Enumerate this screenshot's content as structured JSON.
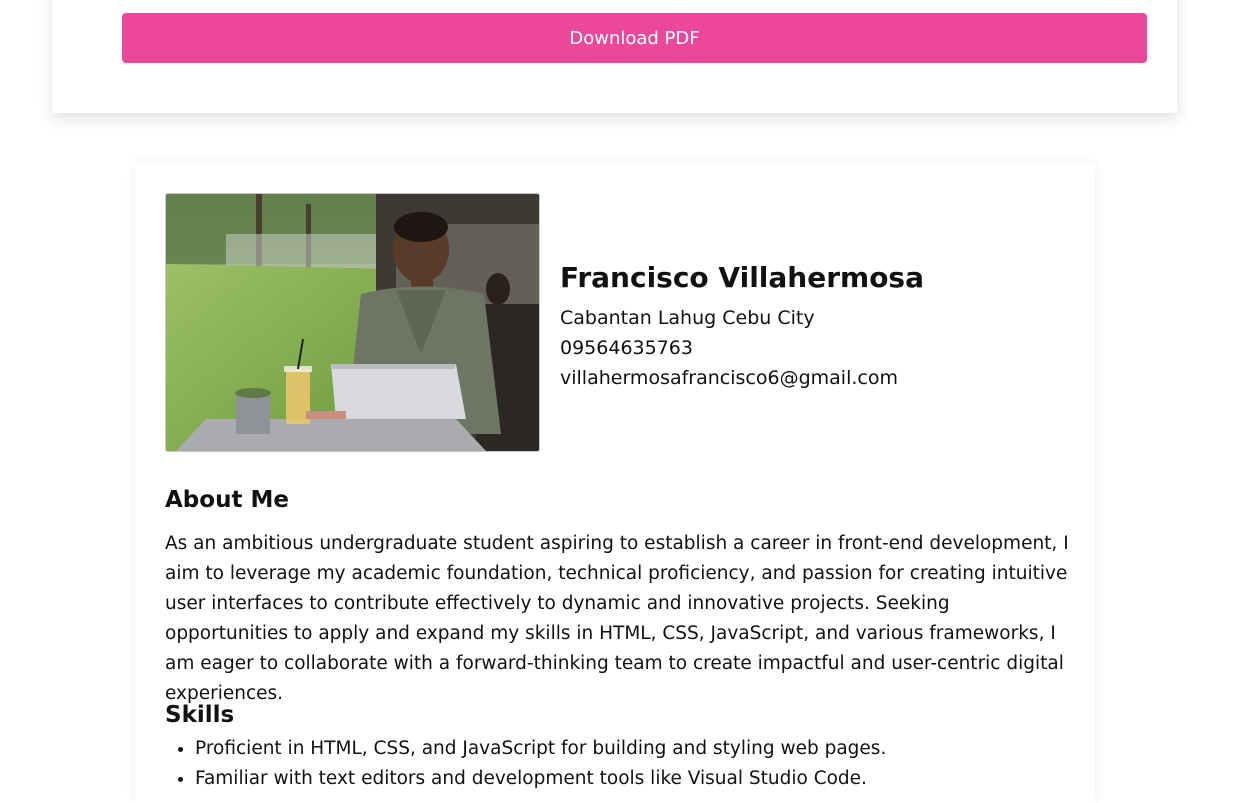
{
  "header": {
    "download_label": "Download PDF"
  },
  "profile": {
    "photo_alt": "Man working on a laptop at an outdoor table",
    "name": "Francisco Villahermosa",
    "address": "Cabantan Lahug Cebu City",
    "phone": "09564635763",
    "email": "villahermosafrancisco6@gmail.com"
  },
  "about": {
    "title": "About Me",
    "text": "As an ambitious undergraduate student aspiring to establish a career in front-end development, I aim to leverage my academic foundation, technical proficiency, and passion for creating intuitive user interfaces to contribute effectively to dynamic and innovative projects. Seeking opportunities to apply and expand my skills in HTML, CSS, JavaScript, and various frameworks, I am eager to collaborate with a forward-thinking team to create impactful and user-centric digital experiences."
  },
  "skills": {
    "title": "Skills",
    "items": [
      "Proficient in HTML, CSS, and JavaScript for building and styling web pages.",
      "Familiar with text editors and development tools like Visual Studio Code."
    ]
  },
  "colors": {
    "accent": "#ec4899"
  }
}
